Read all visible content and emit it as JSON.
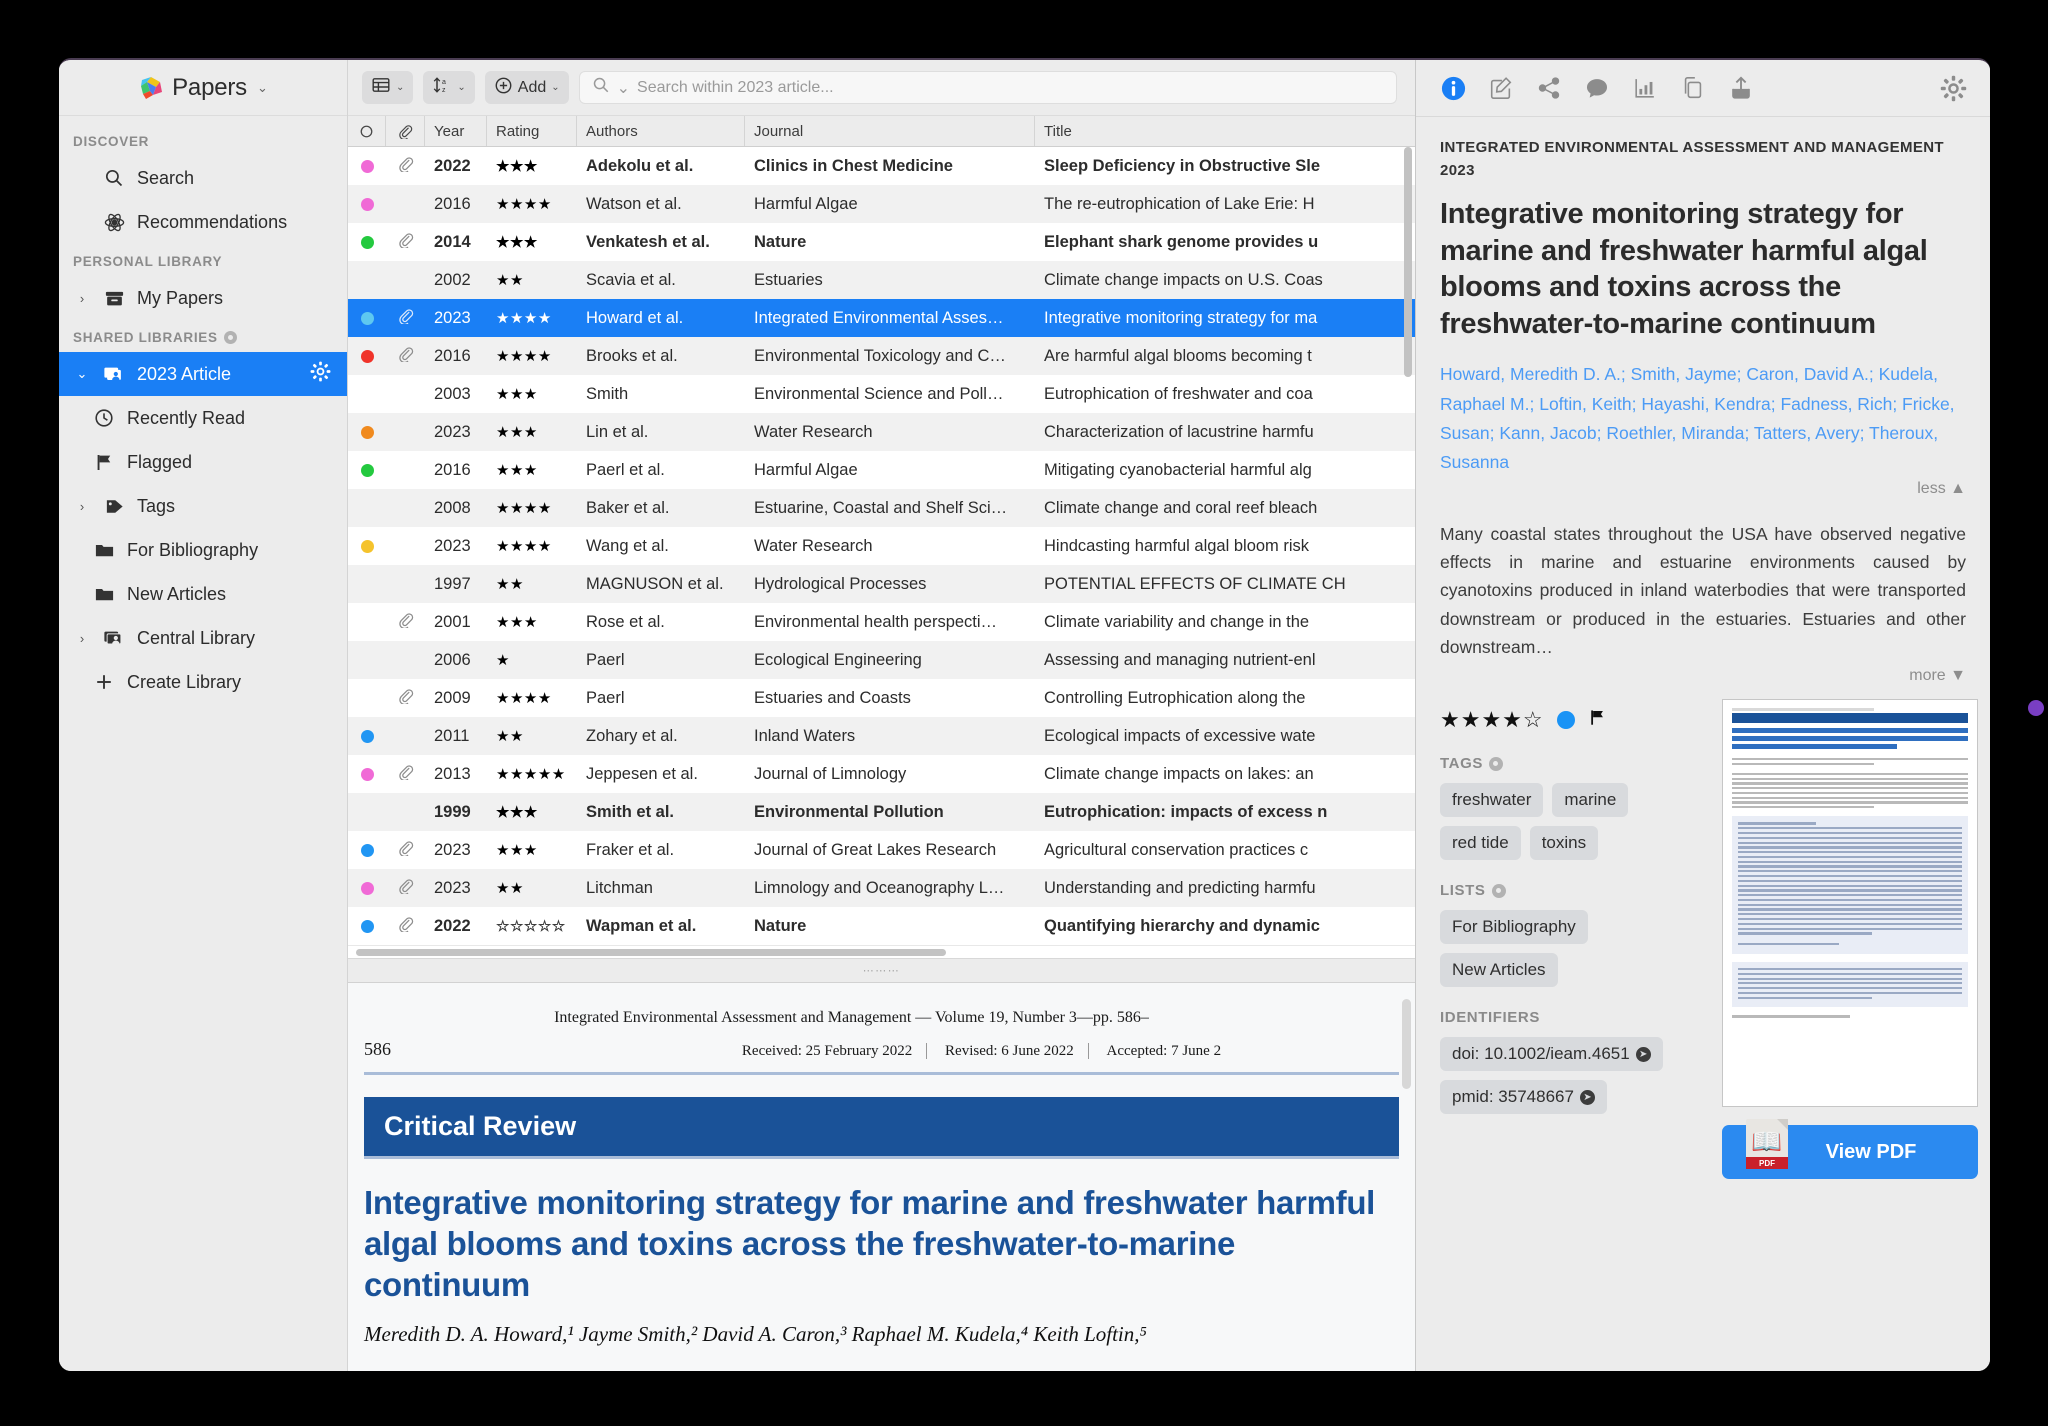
{
  "app": {
    "name": "Papers",
    "caret": "⌄"
  },
  "sidebar": {
    "sections": [
      {
        "header": "DISCOVER",
        "has_icon": false,
        "items": [
          {
            "label": "Search",
            "icon": "search-icon"
          },
          {
            "label": "Recommendations",
            "icon": "atom-icon"
          }
        ]
      },
      {
        "header": "PERSONAL LIBRARY",
        "has_icon": false,
        "items": [
          {
            "label": "My Papers",
            "icon": "archive-icon",
            "caret": "›"
          }
        ]
      },
      {
        "header": "SHARED LIBRARIES",
        "has_icon": true,
        "items": [
          {
            "label": "2023 Article",
            "icon": "shared-library-icon",
            "caret": "⌄",
            "selected": true,
            "gear": "gear-icon"
          },
          {
            "label": "Recently Read",
            "icon": "clock-icon",
            "indent": true
          },
          {
            "label": "Flagged",
            "icon": "flag-icon",
            "indent": true
          },
          {
            "label": "Tags",
            "icon": "tag-icon",
            "caret": "›"
          },
          {
            "label": "For Bibliography",
            "icon": "folder-icon",
            "indent": true
          },
          {
            "label": "New Articles",
            "icon": "folder-icon",
            "indent": true
          },
          {
            "label": "Central Library",
            "icon": "shared-library-icon",
            "caret": "›"
          },
          {
            "label": "Create Library",
            "icon": "plus-icon",
            "indent": true
          }
        ]
      }
    ]
  },
  "toolbar": {
    "view_button": {
      "icon": "table-view-icon",
      "caret": "⌄"
    },
    "sort_button": {
      "icon": "sort-icon",
      "caret": "⌄"
    },
    "add_button": {
      "label": "Add",
      "icon": "plus-circle-icon",
      "caret": "⌄"
    },
    "search": {
      "placeholder": "Search within 2023 article...",
      "value": "",
      "icon": "search-icon",
      "caret": "⌄"
    }
  },
  "table": {
    "columns": [
      "",
      "",
      "Year",
      "Rating",
      "Authors",
      "Journal",
      "Title"
    ],
    "rows": [
      {
        "dot": "#f06ad6",
        "clip": true,
        "year": "2022",
        "rating": 3,
        "authors": "Adekolu et al.",
        "journal": "Clinics in Chest Medicine",
        "title": "Sleep Deficiency in Obstructive Sle",
        "unread": true
      },
      {
        "dot": "#f06ad6",
        "clip": false,
        "year": "2016",
        "rating": 4,
        "authors": "Watson et al.",
        "journal": "Harmful Algae",
        "title": "The re-eutrophication of Lake Erie: H",
        "unread": false
      },
      {
        "dot": "#24c93f",
        "clip": true,
        "year": "2014",
        "rating": 3,
        "authors": "Venkatesh et al.",
        "journal": "Nature",
        "title": "Elephant shark genome provides u",
        "unread": true
      },
      {
        "dot": "",
        "clip": false,
        "year": "2002",
        "rating": 2,
        "authors": "Scavia et al.",
        "journal": "Estuaries",
        "title": "Climate change impacts on U.S. Coas",
        "unread": false
      },
      {
        "dot": "#5ec8f0",
        "clip": true,
        "year": "2023",
        "rating": 4,
        "authors": "Howard et al.",
        "journal": "Integrated Environmental Asses…",
        "title": "Integrative monitoring strategy for ma",
        "unread": false,
        "selected": true
      },
      {
        "dot": "#f0342a",
        "clip": true,
        "year": "2016",
        "rating": 4,
        "authors": "Brooks et al.",
        "journal": "Environmental Toxicology and C…",
        "title": "Are harmful algal blooms becoming t",
        "unread": false
      },
      {
        "dot": "",
        "clip": false,
        "year": "2003",
        "rating": 3,
        "authors": "Smith",
        "journal": "Environmental Science and Poll…",
        "title": "Eutrophication of freshwater and coa",
        "unread": false
      },
      {
        "dot": "#f08a1e",
        "clip": false,
        "year": "2023",
        "rating": 3,
        "authors": "Lin et al.",
        "journal": "Water Research",
        "title": "Characterization of lacustrine harmfu",
        "unread": false
      },
      {
        "dot": "#24c93f",
        "clip": false,
        "year": "2016",
        "rating": 3,
        "authors": "Paerl et al.",
        "journal": "Harmful Algae",
        "title": "Mitigating cyanobacterial harmful alg",
        "unread": false
      },
      {
        "dot": "",
        "clip": false,
        "year": "2008",
        "rating": 4,
        "authors": "Baker et al.",
        "journal": "Estuarine, Coastal and Shelf Sci…",
        "title": "Climate change and coral reef bleach",
        "unread": false
      },
      {
        "dot": "#f5c32c",
        "clip": false,
        "year": "2023",
        "rating": 4,
        "authors": "Wang et al.",
        "journal": "Water Research",
        "title": "Hindcasting harmful algal bloom risk",
        "unread": false
      },
      {
        "dot": "",
        "clip": false,
        "year": "1997",
        "rating": 2,
        "authors": "MAGNUSON et al.",
        "journal": "Hydrological Processes",
        "title": "POTENTIAL EFFECTS OF CLIMATE CH",
        "unread": false
      },
      {
        "dot": "",
        "clip": true,
        "year": "2001",
        "rating": 3,
        "authors": "Rose et al.",
        "journal": "Environmental health perspecti…",
        "title": "Climate variability and change in the",
        "unread": false
      },
      {
        "dot": "",
        "clip": false,
        "year": "2006",
        "rating": 1,
        "authors": "Paerl",
        "journal": "Ecological Engineering",
        "title": "Assessing and managing nutrient-enl",
        "unread": false
      },
      {
        "dot": "",
        "clip": true,
        "year": "2009",
        "rating": 4,
        "authors": "Paerl",
        "journal": "Estuaries and Coasts",
        "title": "Controlling Eutrophication along the",
        "unread": false
      },
      {
        "dot": "#2196f3",
        "clip": false,
        "year": "2011",
        "rating": 2,
        "authors": "Zohary et al.",
        "journal": "Inland Waters",
        "title": "Ecological impacts of excessive wate",
        "unread": false
      },
      {
        "dot": "#f06ad6",
        "clip": true,
        "year": "2013",
        "rating": 5,
        "authors": "Jeppesen et al.",
        "journal": "Journal of Limnology",
        "title": "Climate change impacts on lakes: an",
        "unread": false
      },
      {
        "dot": "",
        "clip": false,
        "year": "1999",
        "rating": 3,
        "authors": "Smith et al.",
        "journal": "Environmental Pollution",
        "title": "Eutrophication: impacts of excess n",
        "unread": true
      },
      {
        "dot": "#2196f3",
        "clip": true,
        "year": "2023",
        "rating": 3,
        "authors": "Fraker et al.",
        "journal": "Journal of Great Lakes Research",
        "title": "Agricultural conservation practices c",
        "unread": false
      },
      {
        "dot": "#f06ad6",
        "clip": true,
        "year": "2023",
        "rating": 2,
        "authors": "Litchman",
        "journal": "Limnology and Oceanography L…",
        "title": "Understanding and predicting harmfu",
        "unread": false
      },
      {
        "dot": "#2196f3",
        "clip": true,
        "year": "2022",
        "rating": 0,
        "authors": "Wapman et al.",
        "journal": "Nature",
        "title": "Quantifying hierarchy and dynamic",
        "unread": true
      }
    ]
  },
  "pdf_preview": {
    "journal_line": "Integrated Environmental Assessment and Management — Volume 19, Number 3—pp. 586–",
    "page_number": "586",
    "received": "Received: 25 February 2022",
    "revised": "Revised: 6 June 2022",
    "accepted": "Accepted: 7 June 2",
    "banner": "Critical Review",
    "title": "Integrative monitoring strategy for marine and freshwater harmful algal blooms and toxins across the freshwater-to-marine continuum",
    "authors_line": "Meredith D. A. Howard,¹ Jayme Smith,² David A. Caron,³ Raphael M. Kudela,⁴ Keith Loftin,⁵"
  },
  "detail": {
    "toolbar_icons": [
      "info-icon",
      "edit-note-icon",
      "share-icon",
      "comment-icon",
      "chart-icon",
      "copy-icon",
      "export-icon",
      "gear-icon"
    ],
    "journal_header": "INTEGRATED ENVIRONMENTAL ASSESSMENT AND MANAGEMENT 2023",
    "title": "Integrative monitoring strategy for marine and freshwater harmful algal blooms and toxins across the freshwater-to-marine continuum",
    "authors": "Howard, Meredith D. A.; Smith, Jayme; Caron, David A.; Kudela, Raphael M.; Loftin, Keith; Hayashi, Kendra; Fadness, Rich; Fricke, Susan; Kann, Jacob; Roethler, Miranda; Tatters, Avery; Theroux, Susanna",
    "less_label": "less",
    "abstract": "Many coastal states throughout the USA have observed negative effects in marine and estuarine environments caused by cyanotoxins produced in inland waterbodies that were transported downstream or produced in the estuaries. Estuaries and other downstream…",
    "more_label": "more",
    "rating": 4,
    "rating_max": 5,
    "tags_label": "TAGS",
    "tags": [
      "freshwater",
      "marine",
      "red tide",
      "toxins"
    ],
    "lists_label": "LISTS",
    "lists": [
      "For Bibliography",
      "New Articles"
    ],
    "identifiers_label": "IDENTIFIERS",
    "identifiers": [
      "doi: 10.1002/ieam.4651",
      "pmid: 35748667"
    ],
    "view_pdf_label": "View PDF"
  },
  "colors": {
    "accent": "#1a7ff5",
    "panel_bg": "#ececec",
    "pdf_blue": "#1a5298"
  }
}
